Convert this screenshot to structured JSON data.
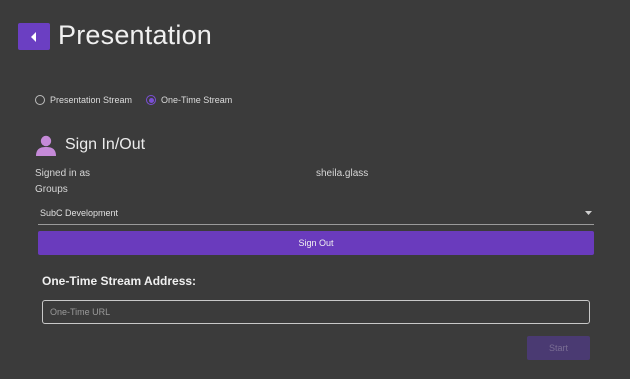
{
  "header": {
    "back_icon": "chevron-left-icon",
    "title": "Presentation"
  },
  "stream_mode": {
    "options": [
      {
        "label": "Presentation Stream",
        "selected": false
      },
      {
        "label": "One-Time Stream",
        "selected": true
      }
    ]
  },
  "signin": {
    "icon": "user-icon",
    "title": "Sign In/Out",
    "signed_in_label": "Signed in as",
    "username": "sheila.glass",
    "groups_label": "Groups",
    "selected_group": "SubC Development",
    "sign_out_label": "Sign Out"
  },
  "one_time_stream": {
    "heading": "One-Time Stream Address:",
    "url_value": "",
    "url_placeholder": "One-Time URL",
    "start_label": "Start",
    "start_enabled": false
  },
  "colors": {
    "background": "#3b3b3b",
    "accent": "#6a3bbd",
    "accent_disabled": "#4a3a72",
    "user_icon": "#c58ad8"
  }
}
